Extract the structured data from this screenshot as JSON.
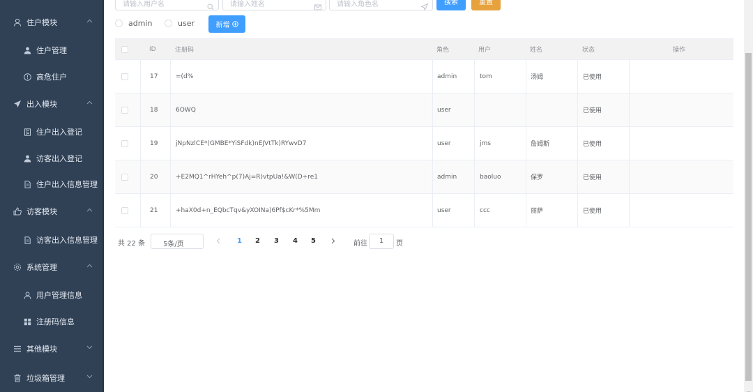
{
  "sidebar": {
    "items": [
      {
        "label": "住户模块",
        "icon": "person-outline-icon",
        "type": "group",
        "expanded": true
      },
      {
        "label": "住户管理",
        "icon": "user-filled-icon",
        "type": "sub"
      },
      {
        "label": "高危住户",
        "icon": "info-circle-icon",
        "type": "sub"
      },
      {
        "label": "出入模块",
        "icon": "paper-plane-icon",
        "type": "group",
        "expanded": true
      },
      {
        "label": "住户出入登记",
        "icon": "notebook-icon",
        "type": "sub"
      },
      {
        "label": "访客出入登记",
        "icon": "user-filled-icon",
        "type": "sub"
      },
      {
        "label": "住户出入信息管理",
        "icon": "document-icon",
        "type": "sub"
      },
      {
        "label": "访客模块",
        "icon": "thumb-up-icon",
        "type": "group",
        "expanded": true
      },
      {
        "label": "访客出入信息管理",
        "icon": "document-icon",
        "type": "sub"
      },
      {
        "label": "系统管理",
        "icon": "gear-icon",
        "type": "group",
        "expanded": true
      },
      {
        "label": "用户管理信息",
        "icon": "person-outline-icon",
        "type": "sub"
      },
      {
        "label": "注册码信息",
        "icon": "grid-icon",
        "type": "sub"
      },
      {
        "label": "其他模块",
        "icon": "menu-lines-icon",
        "type": "group",
        "expanded": false
      },
      {
        "label": "垃圾箱管理",
        "icon": "trash-icon",
        "type": "group",
        "expanded": false
      }
    ]
  },
  "search": {
    "username_placeholder": "请输入用户名",
    "name_placeholder": "请输入姓名",
    "role_placeholder": "请输入角色名",
    "search_label": "搜索",
    "reset_label": "重置"
  },
  "filters": {
    "radio_admin": "admin",
    "radio_user": "user",
    "add_label": "新增"
  },
  "table": {
    "headers": {
      "id": "ID",
      "code": "注册码",
      "role": "角色",
      "user": "用户",
      "name": "姓名",
      "status": "状态",
      "action": "操作"
    },
    "rows": [
      {
        "id": "17",
        "code": "=(d%",
        "role": "admin",
        "user": "tom",
        "name": "汤姆",
        "status": "已使用"
      },
      {
        "id": "18",
        "code": "6OWQ",
        "role": "user",
        "user": "",
        "name": "",
        "status": "已使用"
      },
      {
        "id": "19",
        "code": "jNpNzlCE*(GMBE*YiSFdk)nEJVtTk)RYwvD7",
        "role": "user",
        "user": "jms",
        "name": "詹姆斯",
        "status": "已使用"
      },
      {
        "id": "20",
        "code": "+E2MQ1^rHYeh^p(7)Aj=R)vtpUa!&W(D+re1",
        "role": "admin",
        "user": "baoluo",
        "name": "保罗",
        "status": "已使用"
      },
      {
        "id": "21",
        "code": "+haX0d+n_EQbcTqv&yXOINa)6Pf$cKr*%5Mm",
        "role": "user",
        "user": "ccc",
        "name": "丽萨",
        "status": "已使用"
      }
    ]
  },
  "pagination": {
    "total": "共 22 条",
    "page_size": "5条/页",
    "pages": [
      "1",
      "2",
      "3",
      "4",
      "5"
    ],
    "current": "1",
    "goto_label": "前往",
    "goto_value": "1",
    "page_suffix": "页"
  },
  "colors": {
    "sidebar_bg": "#304156",
    "primary": "#409eff",
    "warning": "#e6a23c"
  }
}
